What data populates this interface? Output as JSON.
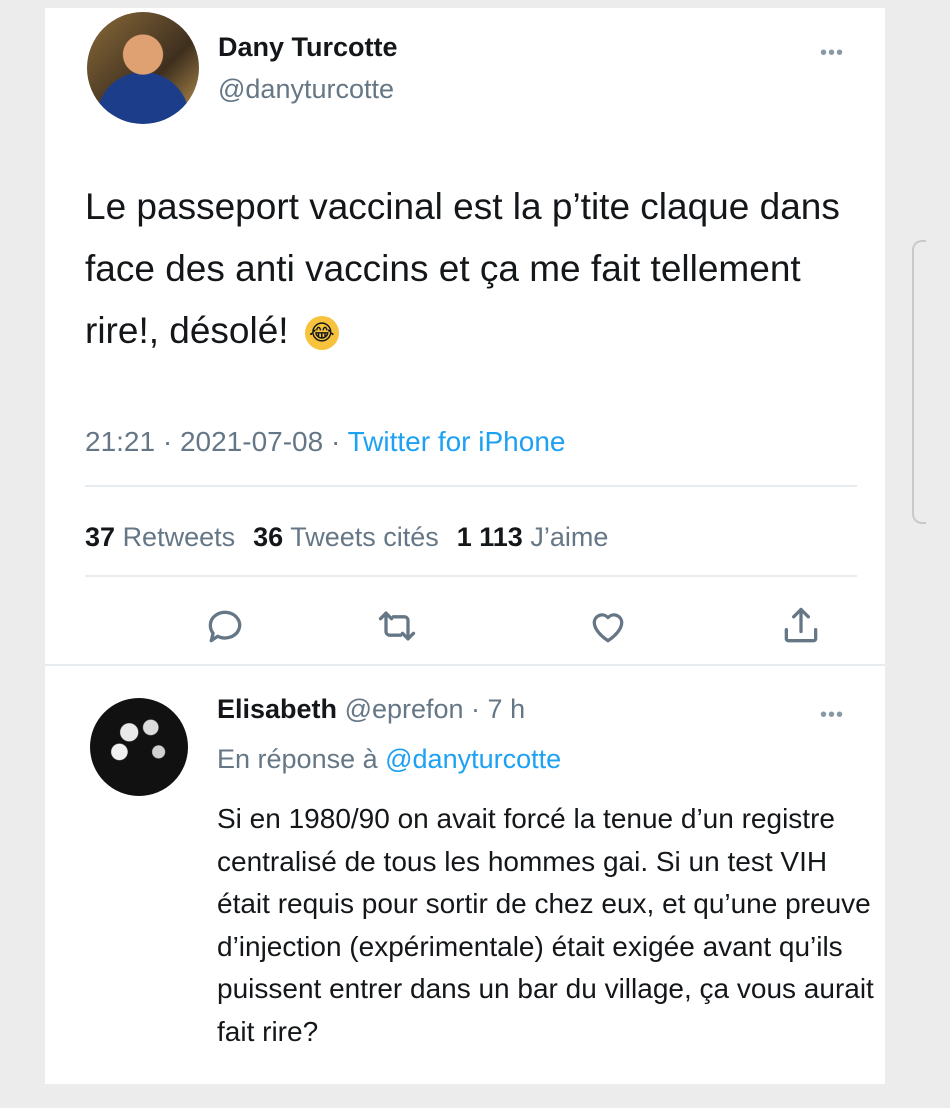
{
  "tweet": {
    "author_name": "Dany Turcotte",
    "author_handle": "@danyturcotte",
    "more_label": "•••",
    "text": "Le passeport vaccinal est la p’tite claque dans face des anti vaccins et ça me fait tellement rire!, désolé!",
    "emoji": "😂",
    "time": "21:21",
    "date": "2021-07-08",
    "separator": " · ",
    "source": "Twitter for iPhone",
    "stats": {
      "retweets_count": "37",
      "retweets_label": "Retweets",
      "quotes_count": "36",
      "quotes_label": "Tweets cités",
      "likes_count": "1 113",
      "likes_label": "J’aime"
    },
    "icons": [
      "reply-icon",
      "retweet-icon",
      "like-icon",
      "share-icon"
    ]
  },
  "reply": {
    "author_name": "Elisabeth",
    "author_handle": "@eprefon",
    "age": "7 h",
    "separator": " · ",
    "more_label": "•••",
    "in_reply_prefix": "En réponse à ",
    "in_reply_handle": "@danyturcotte",
    "text": "Si en 1980/90 on avait forcé la tenue d’un registre centralisé de tous les hommes gai. Si un test VIH était requis pour sortir de chez eux, et qu’une preuve d’injection (expérimentale) était exigée avant qu’ils puissent entrer dans un bar du village, ça vous aurait fait rire?"
  },
  "colors": {
    "accent": "#1da1f2",
    "muted": "#657786",
    "text": "#14171a",
    "divider": "#e6ecf0"
  }
}
